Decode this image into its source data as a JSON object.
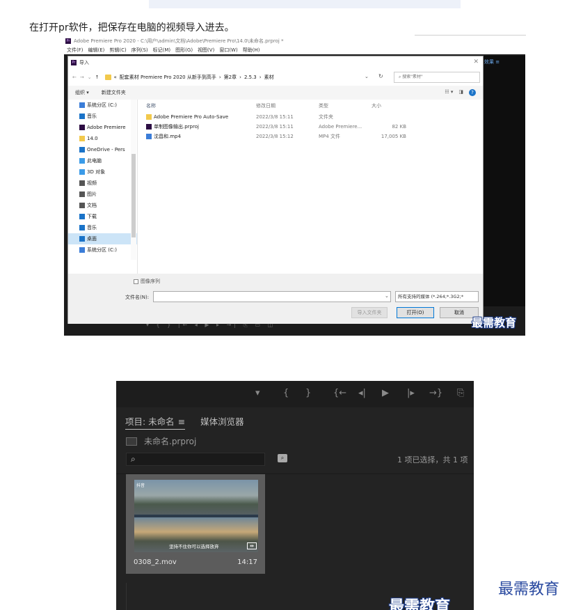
{
  "caption": "在打开pr软件，把保存在电脑的视频导入进去。",
  "premiere": {
    "title": "Adobe Premiere Pro 2020 - C:\\用户\\admin\\文档\\Adobe\\Premiere Pro\\14.0\\未命名.prproj *",
    "menus": [
      "文件(F)",
      "编辑(E)",
      "剪辑(C)",
      "序列(S)",
      "标记(M)",
      "图形(G)",
      "视图(V)",
      "窗口(W)",
      "帮助(H)"
    ],
    "right_panel_label": "效果  ≡"
  },
  "dialog": {
    "title": "导入",
    "path_segments": [
      "«",
      "配套素材 Premiere Pro 2020 从新手到高手",
      "›",
      "第2章",
      "›",
      "2.5.3",
      "›",
      "素材"
    ],
    "search_placeholder": "搜索\"素材\"",
    "toolbar": {
      "organize": "组织 ▾",
      "new_folder": "新建文件夹"
    },
    "nav_items": [
      {
        "label": "系统分区 (C:)",
        "icon": "drive-icon",
        "color": "#3b7dd8"
      },
      {
        "label": "音乐",
        "icon": "music-icon",
        "color": "#1a73c8"
      },
      {
        "label": "Adobe Premiere",
        "icon": "premiere-icon",
        "color": "#2d0e44"
      },
      {
        "label": "14.0",
        "icon": "folder-icon",
        "color": "#f2c94c"
      },
      {
        "label": "OneDrive - Pers",
        "icon": "cloud-icon",
        "color": "#1a73c8"
      },
      {
        "label": "此电脑",
        "icon": "computer-icon",
        "color": "#3b9be8"
      },
      {
        "label": "3D 对象",
        "icon": "cube-icon",
        "color": "#3b9be8"
      },
      {
        "label": "视频",
        "icon": "video-icon",
        "color": "#555555"
      },
      {
        "label": "图片",
        "icon": "picture-icon",
        "color": "#555555"
      },
      {
        "label": "文档",
        "icon": "document-icon",
        "color": "#555555"
      },
      {
        "label": "下载",
        "icon": "download-icon",
        "color": "#1a73c8"
      },
      {
        "label": "音乐",
        "icon": "music-icon",
        "color": "#1a73c8"
      },
      {
        "label": "桌面",
        "icon": "desktop-icon",
        "color": "#1a73c8"
      },
      {
        "label": "系统分区 (C:)",
        "icon": "drive-icon",
        "color": "#3b7dd8"
      }
    ],
    "columns": [
      "名称",
      "修改日期",
      "类型",
      "大小"
    ],
    "files": [
      {
        "name": "Adobe Premiere Pro Auto-Save",
        "date": "2022/3/8 15:11",
        "type": "文件夹",
        "size": "",
        "icon": "folder-icon"
      },
      {
        "name": "单制图像输出.prproj",
        "date": "2022/3/8 15:11",
        "type": "Adobe Premiere...",
        "size": "82 KB",
        "icon": "premiere-icon"
      },
      {
        "name": "沈昌和.mp4",
        "date": "2022/3/8 15:12",
        "type": "MP4 文件",
        "size": "17,005 KB",
        "icon": "video-file-icon"
      }
    ],
    "image_sequence_label": "图像序列",
    "filename_label": "文件名(N):",
    "filename_value": "",
    "filter_value": "所有支持的媒体 (*.264;*.3G2;*",
    "btn_import_folder": "导入文件夹",
    "btn_open": "打开(O)",
    "btn_cancel": "取消"
  },
  "project_panel": {
    "tab_project": "项目: 未命名",
    "tab_media": "媒体浏览器",
    "project_file": "未命名.prproj",
    "status": "1 项已选择，共 1 项",
    "clip": {
      "badge": "抖音",
      "caption": "坚持不住你可以选择放弃",
      "name": "0308_2.mov",
      "duration": "14:17"
    }
  },
  "watermark": "最需教育",
  "colors": {
    "premiere_dark": "#232323",
    "accent_blue": "#0078d7",
    "folder_yellow": "#f2c94c"
  }
}
